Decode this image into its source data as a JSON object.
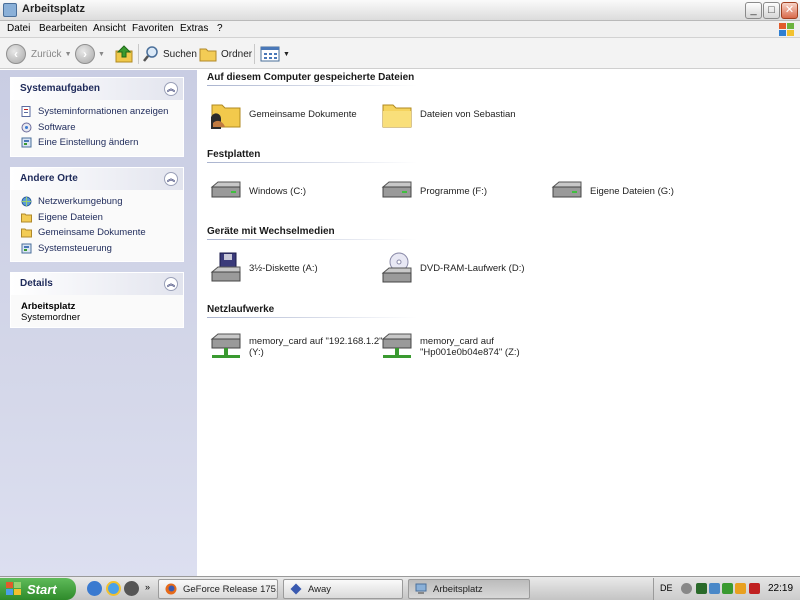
{
  "window": {
    "title": "Arbeitsplatz",
    "controls": {
      "minimize": "_",
      "maximize": "□",
      "close": "✕"
    }
  },
  "menu": [
    "Datei",
    "Bearbeiten",
    "Ansicht",
    "Favoriten",
    "Extras",
    "?"
  ],
  "toolbar": {
    "back": "Zurück",
    "search": "Suchen",
    "folders": "Ordner"
  },
  "sidebar": {
    "system_tasks": {
      "title": "Systemaufgaben",
      "items": [
        "Systeminformationen anzeigen",
        "Software",
        "Eine Einstellung ändern"
      ]
    },
    "other_places": {
      "title": "Andere Orte",
      "items": [
        "Netzwerkumgebung",
        "Eigene Dateien",
        "Gemeinsame Dokumente",
        "Systemsteuerung"
      ]
    },
    "details": {
      "title": "Details",
      "name": "Arbeitsplatz",
      "type": "Systemordner"
    }
  },
  "main": {
    "stored_files": {
      "title": "Auf diesem Computer gespeicherte Dateien",
      "items": [
        "Gemeinsame Dokumente",
        "Dateien von Sebastian"
      ]
    },
    "hard_disks": {
      "title": "Festplatten",
      "items": [
        "Windows (C:)",
        "Programme (F:)",
        "Eigene Dateien (G:)"
      ]
    },
    "removable": {
      "title": "Geräte mit Wechselmedien",
      "items": [
        "3½-Diskette (A:)",
        "DVD-RAM-Laufwerk (D:)"
      ]
    },
    "network_drives": {
      "title": "Netzlaufwerke",
      "items": [
        {
          "line1": "memory_card auf \"192.168.1.2\"",
          "line2": "(Y:)"
        },
        {
          "line1": "memory_card auf",
          "line2": "\"Hp001e0b04e874\" (Z:)"
        }
      ]
    }
  },
  "taskbar": {
    "start": "Start",
    "tasks": [
      "GeForce Release 175....",
      "Away",
      "Arbeitsplatz"
    ],
    "language": "DE",
    "clock": "22:19"
  },
  "colors": {
    "sidebar_bg": "#d0d3e8",
    "start_green": "#3c9a37",
    "title_text": "#1e2a5a"
  }
}
